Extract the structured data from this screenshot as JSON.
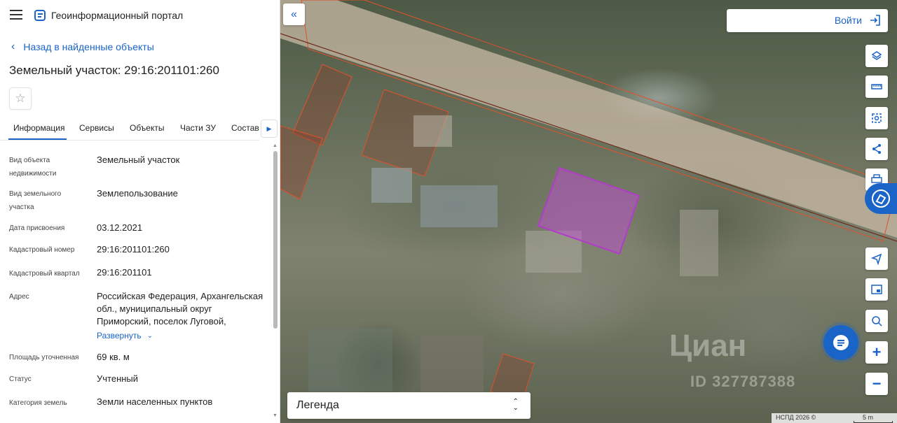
{
  "app": {
    "title": "Геоинформационный портал"
  },
  "nav": {
    "back_label": "Назад в найденные объекты"
  },
  "object": {
    "title": "Земельный участок: 29:16:201101:260"
  },
  "tabs": [
    {
      "label": "Информация",
      "active": true
    },
    {
      "label": "Сервисы"
    },
    {
      "label": "Объекты"
    },
    {
      "label": "Части ЗУ"
    },
    {
      "label": "Состав"
    }
  ],
  "properties": [
    {
      "label": "Вид объекта недвижимости",
      "value": "Земельный участок"
    },
    {
      "label": "Вид земельного участка",
      "value": "Землепользование"
    },
    {
      "label": "Дата присвоения",
      "value": "03.12.2021"
    },
    {
      "label": "Кадастровый номер",
      "value": "29:16:201101:260"
    },
    {
      "label": "Кадастровый квартал",
      "value": "29:16:201101"
    },
    {
      "label": "Адрес",
      "value": "Российская Федерация, Архангельская обл., муниципальный округ Приморский, поселок Луговой,"
    },
    {
      "label": "Площадь уточненная",
      "value": "69 кв. м"
    },
    {
      "label": "Статус",
      "value": "Учтенный"
    },
    {
      "label": "Категория земель",
      "value": "Земли населенных пунктов"
    }
  ],
  "expand_label": "Развернуть",
  "map": {
    "login_label": "Войти",
    "legend_label": "Легенда",
    "watermark": "Циан",
    "watermark_id": "ID 327787388",
    "attribution": "НСПД 2026 ©",
    "scale_label": "5 m",
    "tools": [
      "layers-icon",
      "ruler-icon",
      "select-area-icon",
      "share-icon",
      "print-icon",
      "locate-icon",
      "minimap-icon",
      "geo-search-icon",
      "zoom-in-icon",
      "zoom-out-icon"
    ]
  },
  "colors": {
    "accent": "#1a63c7",
    "parcel_highlight": "#b03cc8",
    "parcel_border": "#e0512b"
  }
}
